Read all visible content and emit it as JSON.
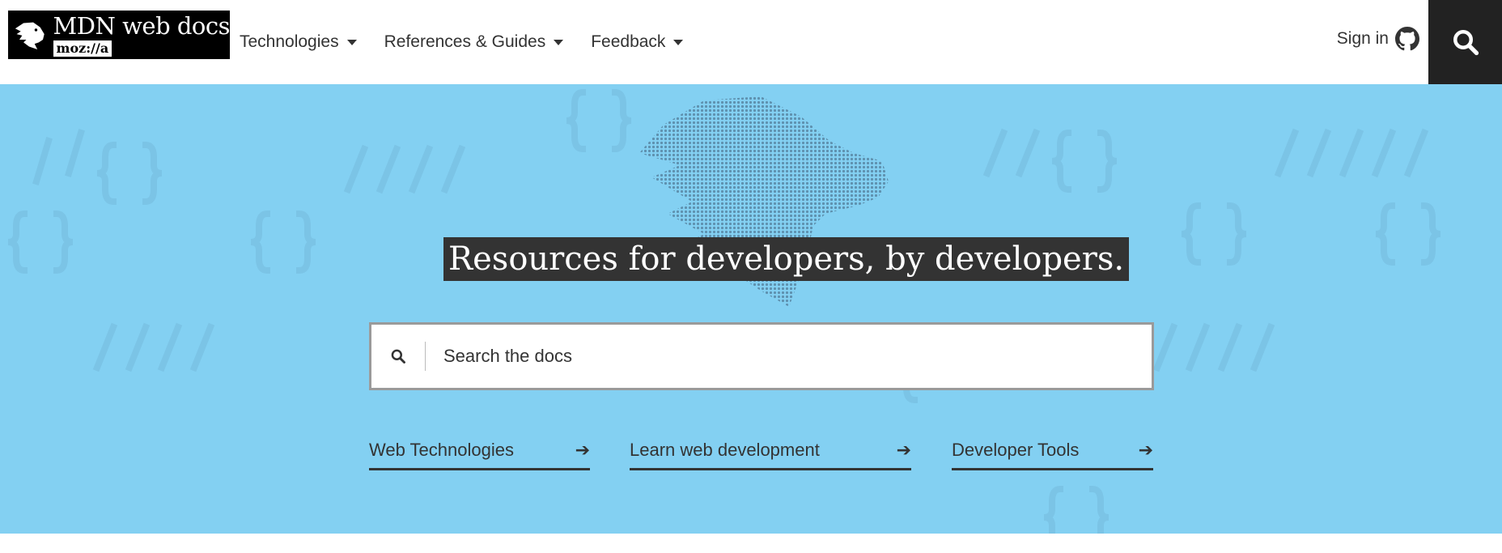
{
  "header": {
    "logo": {
      "title": "MDN web docs",
      "subtitle": "moz://a"
    },
    "nav": [
      {
        "label": "Technologies"
      },
      {
        "label": "References & Guides"
      },
      {
        "label": "Feedback"
      }
    ],
    "signin_label": "Sign in",
    "icons": {
      "github": "github-icon",
      "search": "search-icon"
    }
  },
  "hero": {
    "tagline": "Resources for developers, by developers.",
    "search": {
      "placeholder": "Search the docs"
    },
    "links": [
      {
        "label": "Web Technologies"
      },
      {
        "label": "Learn web development"
      },
      {
        "label": "Developer Tools"
      }
    ]
  },
  "colors": {
    "hero_bg": "#83d0f2",
    "dark": "#333333",
    "search_button_bg": "#222222"
  }
}
